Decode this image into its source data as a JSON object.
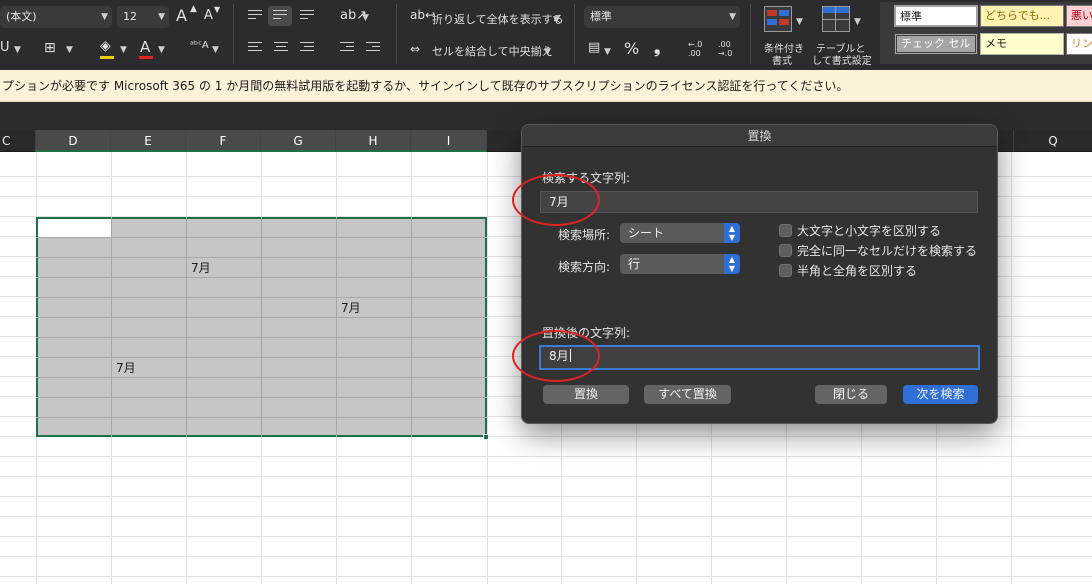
{
  "ribbon": {
    "font_name": "(本文)",
    "font_size": "12",
    "grow_font_label": "A",
    "shrink_font_label": "A",
    "font_color_label": "A",
    "wrap_text_label": "折り返して全体を表示する",
    "merge_center_label": "セルを結合して中央揃え",
    "number_format": "標準",
    "percent_label": "%",
    "comma_label": "❟",
    "inc_decimal_label": "←.0 .00",
    "dec_decimal_label": ".00 →.0",
    "cond_format_label_1": "条件付き",
    "cond_format_label_2": "書式",
    "table_format_label_1": "テーブルと",
    "table_format_label_2": "して書式設定",
    "styles": {
      "normal": "標準",
      "neutral": "どちらでも...",
      "bad": "悪い",
      "check_cell": "チェック セル",
      "note": "メモ",
      "link": "リン"
    }
  },
  "license_bar": {
    "message": "プションが必要です  Microsoft 365 の 1 か月間の無料試用版を起動するか、サインインして既存のサブスクリプションのライセンス認証を行ってください。"
  },
  "columns": [
    "C",
    "D",
    "E",
    "F",
    "G",
    "H",
    "I",
    "Q"
  ],
  "cells": {
    "f_row3": "7月",
    "h_row5": "7月",
    "e_row8": "7月"
  },
  "dialog": {
    "title": "置換",
    "find_label": "検索する文字列:",
    "find_value": "7月",
    "scope_label": "検索場所:",
    "scope_value": "シート",
    "direction_label": "検索方向:",
    "direction_value": "行",
    "option_case": "大文字と小文字を区別する",
    "option_whole": "完全に同一なセルだけを検索する",
    "option_width": "半角と全角を区別する",
    "replace_label": "置換後の文字列:",
    "replace_value": "8月",
    "btn_replace": "置換",
    "btn_replace_all": "すべて置換",
    "btn_close": "閉じる",
    "btn_find_next": "次を検索"
  },
  "colors": {
    "selection_border": "#1e7145",
    "annotation": "#e02424",
    "primary_button": "#2f6fd6"
  }
}
